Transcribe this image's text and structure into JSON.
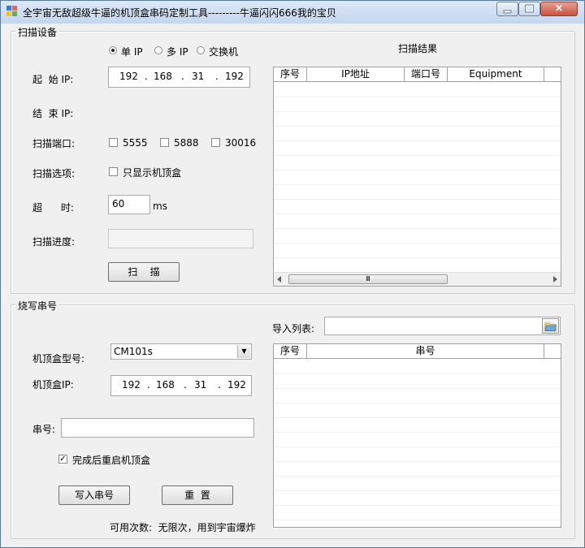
{
  "window": {
    "title": "全宇宙无敌超级牛逼的机顶盒串码定制工具---------牛逼闪闪666我的宝贝",
    "close_label": "×"
  },
  "scan": {
    "group_title": "扫描设备",
    "modes": [
      "单 IP",
      "多 IP",
      "交换机"
    ],
    "selected_mode": "单 IP",
    "start_ip_label": "起  始 IP:",
    "start_ip": [
      "192",
      "168",
      "31",
      "192"
    ],
    "end_ip_label": "结  束 IP:",
    "ports_label": "扫描端口:",
    "ports": [
      "5555",
      "5888",
      "30016"
    ],
    "options_label": "扫描选项:",
    "only_stb_label": "只显示机顶盒",
    "timeout_label": "超      时:",
    "timeout_value": "60",
    "timeout_unit": "ms",
    "progress_label": "扫描进度:",
    "progress": 0,
    "scan_button": "扫    描",
    "results_title": "扫描结果",
    "results_columns": [
      "序号",
      "IP地址",
      "端口号",
      "Equipment"
    ]
  },
  "burn": {
    "group_title": "烧写串号",
    "import_label": "导入列表:",
    "import_value": "",
    "model_label": "机顶盒型号:",
    "model_value": "CM101s",
    "ip_label": "机顶盒IP:",
    "ip": [
      "192",
      "168",
      "31",
      "192"
    ],
    "serial_label": "串号:",
    "serial_value": "",
    "reboot_label": "完成后重启机顶盒",
    "reboot_checked": true,
    "write_button": "写入串号",
    "reset_button": "重  置",
    "usage_text": "可用次数:  无限次，用到宇宙爆炸",
    "list_columns": [
      "序号",
      "串号"
    ]
  }
}
